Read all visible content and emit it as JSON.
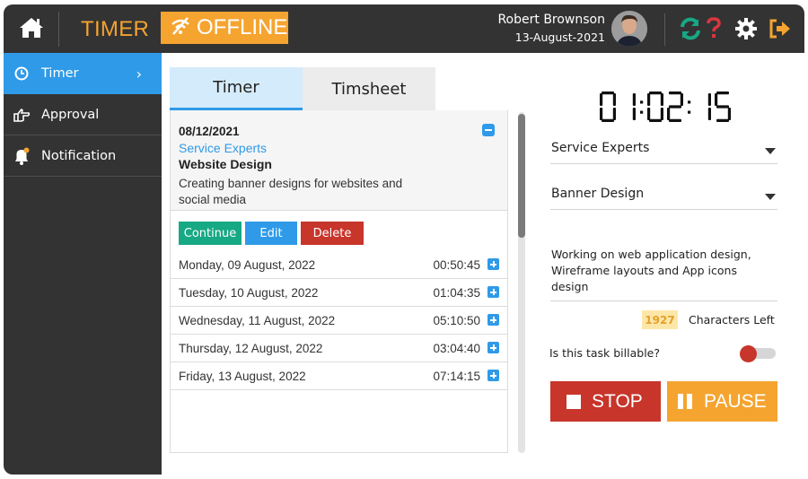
{
  "header": {
    "app_title": "TIMER",
    "status_label": "OFFLINE",
    "user_name": "Robert Brownson",
    "user_date": "13-August-2021",
    "icons": [
      "home-icon",
      "offline-icon",
      "sync-icon",
      "help-icon",
      "gear-icon",
      "logout-icon"
    ]
  },
  "sidebar": {
    "items": [
      {
        "label": "Timer",
        "icon": "clock-icon",
        "active": true
      },
      {
        "label": "Approval",
        "icon": "hand-pointing-icon",
        "active": false
      },
      {
        "label": "Notification",
        "icon": "bell-icon",
        "active": false
      }
    ]
  },
  "tabs": [
    {
      "label": "Timer",
      "active": true
    },
    {
      "label": "Timsheet",
      "active": false
    }
  ],
  "entry": {
    "date": "08/12/2021",
    "client": "Service Experts",
    "project": "Website Design",
    "description": "Creating banner designs for websites and social media",
    "buttons": {
      "continue": "Continue",
      "edit": "Edit",
      "delete": "Delete"
    }
  },
  "timesheet_rows": [
    {
      "day": "Monday, 09 August, 2022",
      "time": "00:50:45"
    },
    {
      "day": "Tuesday, 10 August, 2022",
      "time": "01:04:35"
    },
    {
      "day": "Wednesday, 11 August, 2022",
      "time": "05:10:50"
    },
    {
      "day": "Thursday, 12 August, 2022",
      "time": "03:04:40"
    },
    {
      "day": "Friday, 13 August, 2022",
      "time": "07:14:15"
    }
  ],
  "timer": {
    "display": "01:02:15",
    "client_select": "Service Experts",
    "task_select": "Banner Design",
    "notes": "Working on web application design, Wireframe layouts and App icons design",
    "chars_left_count": "1927",
    "chars_left_label": "Characters Left",
    "billable_label": "Is this task billable?",
    "billable": false,
    "stop_label": "STOP",
    "pause_label": "PAUSE"
  },
  "colors": {
    "header_bg": "#333333",
    "accent_orange": "#f5a430",
    "accent_blue": "#2f9ae8",
    "green": "#17a884",
    "red": "#c7352b"
  }
}
